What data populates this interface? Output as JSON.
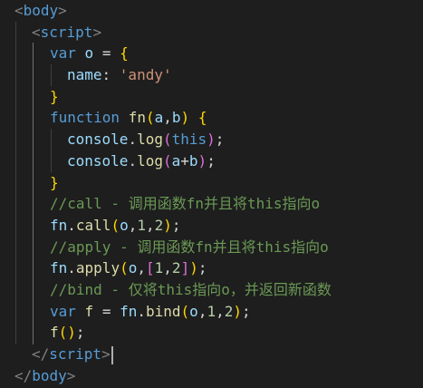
{
  "editor": {
    "lines": [
      {
        "tokens": [
          {
            "t": "<",
            "c": "tag-punc"
          },
          {
            "t": "body",
            "c": "tag-name"
          },
          {
            "t": ">",
            "c": "tag-punc"
          }
        ],
        "indent": 16
      },
      {
        "tokens": [
          {
            "t": "<",
            "c": "tag-punc"
          },
          {
            "t": "script",
            "c": "tag-name"
          },
          {
            "t": ">",
            "c": "tag-punc"
          }
        ],
        "indent": 35
      },
      {
        "tokens": [
          {
            "t": "var",
            "c": "kw"
          },
          {
            "t": " ",
            "c": "pun"
          },
          {
            "t": "o",
            "c": "var"
          },
          {
            "t": " = ",
            "c": "pun"
          },
          {
            "t": "{",
            "c": "b1"
          }
        ],
        "indent": 55
      },
      {
        "tokens": [
          {
            "t": "name",
            "c": "prop"
          },
          {
            "t": ": ",
            "c": "pun"
          },
          {
            "t": "'andy'",
            "c": "str"
          }
        ],
        "indent": 74
      },
      {
        "tokens": [
          {
            "t": "}",
            "c": "b1"
          }
        ],
        "indent": 55
      },
      {
        "tokens": [
          {
            "t": "function",
            "c": "kw"
          },
          {
            "t": " ",
            "c": "pun"
          },
          {
            "t": "fn",
            "c": "fn"
          },
          {
            "t": "(",
            "c": "b1"
          },
          {
            "t": "a",
            "c": "var"
          },
          {
            "t": ",",
            "c": "pun"
          },
          {
            "t": "b",
            "c": "var"
          },
          {
            "t": ")",
            "c": "b1"
          },
          {
            "t": " ",
            "c": "pun"
          },
          {
            "t": "{",
            "c": "b1"
          }
        ],
        "indent": 55
      },
      {
        "tokens": [
          {
            "t": "console",
            "c": "var"
          },
          {
            "t": ".",
            "c": "pun"
          },
          {
            "t": "log",
            "c": "fn"
          },
          {
            "t": "(",
            "c": "b2"
          },
          {
            "t": "this",
            "c": "kw"
          },
          {
            "t": ")",
            "c": "b2"
          },
          {
            "t": ";",
            "c": "pun"
          }
        ],
        "indent": 74
      },
      {
        "tokens": [
          {
            "t": "console",
            "c": "var"
          },
          {
            "t": ".",
            "c": "pun"
          },
          {
            "t": "log",
            "c": "fn"
          },
          {
            "t": "(",
            "c": "b2"
          },
          {
            "t": "a",
            "c": "var"
          },
          {
            "t": "+",
            "c": "pun"
          },
          {
            "t": "b",
            "c": "var"
          },
          {
            "t": ")",
            "c": "b2"
          },
          {
            "t": ";",
            "c": "pun"
          }
        ],
        "indent": 74
      },
      {
        "tokens": [
          {
            "t": "}",
            "c": "b1"
          }
        ],
        "indent": 55
      },
      {
        "tokens": [
          {
            "t": "//call - 调用函数fn并且将this指向o",
            "c": "cm"
          }
        ],
        "indent": 55
      },
      {
        "tokens": [
          {
            "t": "fn",
            "c": "var"
          },
          {
            "t": ".",
            "c": "pun"
          },
          {
            "t": "call",
            "c": "fn"
          },
          {
            "t": "(",
            "c": "b1"
          },
          {
            "t": "o",
            "c": "var"
          },
          {
            "t": ",",
            "c": "pun"
          },
          {
            "t": "1",
            "c": "num"
          },
          {
            "t": ",",
            "c": "pun"
          },
          {
            "t": "2",
            "c": "num"
          },
          {
            "t": ")",
            "c": "b1"
          },
          {
            "t": ";",
            "c": "pun"
          }
        ],
        "indent": 55
      },
      {
        "tokens": [
          {
            "t": "//apply - 调用函数fn并且将this指向o",
            "c": "cm"
          }
        ],
        "indent": 55
      },
      {
        "tokens": [
          {
            "t": "fn",
            "c": "var"
          },
          {
            "t": ".",
            "c": "pun"
          },
          {
            "t": "apply",
            "c": "fn"
          },
          {
            "t": "(",
            "c": "b1"
          },
          {
            "t": "o",
            "c": "var"
          },
          {
            "t": ",",
            "c": "pun"
          },
          {
            "t": "[",
            "c": "b2"
          },
          {
            "t": "1",
            "c": "num"
          },
          {
            "t": ",",
            "c": "pun"
          },
          {
            "t": "2",
            "c": "num"
          },
          {
            "t": "]",
            "c": "b2"
          },
          {
            "t": ")",
            "c": "b1"
          },
          {
            "t": ";",
            "c": "pun"
          }
        ],
        "indent": 55
      },
      {
        "tokens": [
          {
            "t": "//bind - 仅将this指向o，并返回新函数",
            "c": "cm"
          }
        ],
        "indent": 55
      },
      {
        "tokens": [
          {
            "t": "var",
            "c": "kw"
          },
          {
            "t": " ",
            "c": "pun"
          },
          {
            "t": "f",
            "c": "fn"
          },
          {
            "t": " = ",
            "c": "pun"
          },
          {
            "t": "fn",
            "c": "var"
          },
          {
            "t": ".",
            "c": "pun"
          },
          {
            "t": "bind",
            "c": "fn"
          },
          {
            "t": "(",
            "c": "b1"
          },
          {
            "t": "o",
            "c": "var"
          },
          {
            "t": ",",
            "c": "pun"
          },
          {
            "t": "1",
            "c": "num"
          },
          {
            "t": ",",
            "c": "pun"
          },
          {
            "t": "2",
            "c": "num"
          },
          {
            "t": ")",
            "c": "b1"
          },
          {
            "t": ";",
            "c": "pun"
          }
        ],
        "indent": 55
      },
      {
        "tokens": [
          {
            "t": "f",
            "c": "fn"
          },
          {
            "t": "(",
            "c": "b1"
          },
          {
            "t": ")",
            "c": "b1"
          },
          {
            "t": ";",
            "c": "pun"
          }
        ],
        "indent": 55
      },
      {
        "tokens": [
          {
            "t": "</",
            "c": "tag-punc"
          },
          {
            "t": "script",
            "c": "tag-name"
          },
          {
            "t": ">",
            "c": "tag-punc"
          }
        ],
        "indent": 35,
        "cursor": true
      },
      {
        "tokens": [
          {
            "t": "</",
            "c": "tag-punc"
          },
          {
            "t": "body",
            "c": "tag-name"
          },
          {
            "t": ">",
            "c": "tag-punc"
          }
        ],
        "indent": 16
      }
    ],
    "colors": {
      "background": "#1e1e1e",
      "keyword": "#569cd6",
      "variable": "#9cdcfe",
      "string": "#ce9178",
      "function": "#dcdcaa",
      "number": "#b5cea8",
      "comment": "#6a9955",
      "bracket_level1": "#ffd700",
      "bracket_level2": "#da70d6"
    }
  }
}
